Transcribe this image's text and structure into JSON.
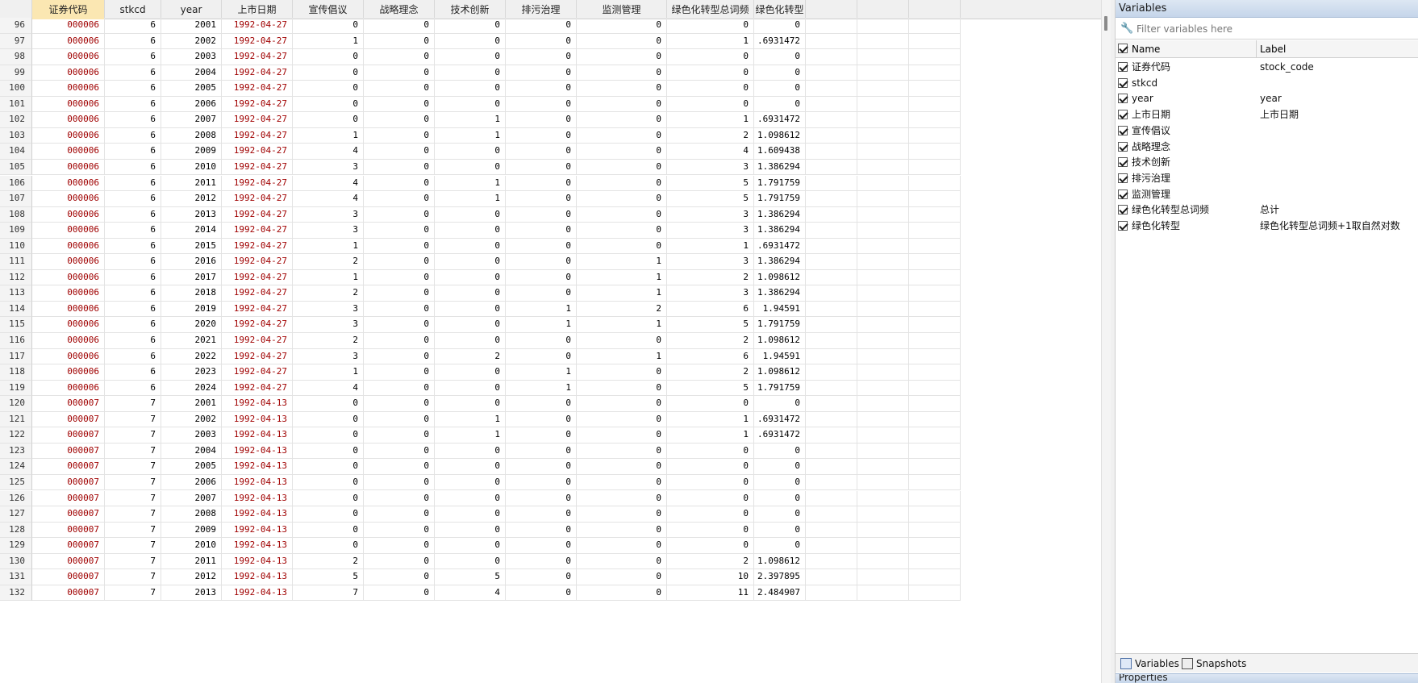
{
  "grid": {
    "columns": [
      "证券代码",
      "stkcd",
      "year",
      "上市日期",
      "宣传倡议",
      "战略理念",
      "技术创新",
      "排污治理",
      "监测管理",
      "绿色化转型总词频",
      "绿色化转型"
    ],
    "rows": [
      [
        "96",
        "000006",
        "6",
        "2001",
        "1992-04-27",
        "0",
        "0",
        "0",
        "0",
        "0",
        "0",
        "0"
      ],
      [
        "97",
        "000006",
        "6",
        "2002",
        "1992-04-27",
        "1",
        "0",
        "0",
        "0",
        "0",
        "1",
        ".6931472"
      ],
      [
        "98",
        "000006",
        "6",
        "2003",
        "1992-04-27",
        "0",
        "0",
        "0",
        "0",
        "0",
        "0",
        "0"
      ],
      [
        "99",
        "000006",
        "6",
        "2004",
        "1992-04-27",
        "0",
        "0",
        "0",
        "0",
        "0",
        "0",
        "0"
      ],
      [
        "100",
        "000006",
        "6",
        "2005",
        "1992-04-27",
        "0",
        "0",
        "0",
        "0",
        "0",
        "0",
        "0"
      ],
      [
        "101",
        "000006",
        "6",
        "2006",
        "1992-04-27",
        "0",
        "0",
        "0",
        "0",
        "0",
        "0",
        "0"
      ],
      [
        "102",
        "000006",
        "6",
        "2007",
        "1992-04-27",
        "0",
        "0",
        "1",
        "0",
        "0",
        "1",
        ".6931472"
      ],
      [
        "103",
        "000006",
        "6",
        "2008",
        "1992-04-27",
        "1",
        "0",
        "1",
        "0",
        "0",
        "2",
        "1.098612"
      ],
      [
        "104",
        "000006",
        "6",
        "2009",
        "1992-04-27",
        "4",
        "0",
        "0",
        "0",
        "0",
        "4",
        "1.609438"
      ],
      [
        "105",
        "000006",
        "6",
        "2010",
        "1992-04-27",
        "3",
        "0",
        "0",
        "0",
        "0",
        "3",
        "1.386294"
      ],
      [
        "106",
        "000006",
        "6",
        "2011",
        "1992-04-27",
        "4",
        "0",
        "1",
        "0",
        "0",
        "5",
        "1.791759"
      ],
      [
        "107",
        "000006",
        "6",
        "2012",
        "1992-04-27",
        "4",
        "0",
        "1",
        "0",
        "0",
        "5",
        "1.791759"
      ],
      [
        "108",
        "000006",
        "6",
        "2013",
        "1992-04-27",
        "3",
        "0",
        "0",
        "0",
        "0",
        "3",
        "1.386294"
      ],
      [
        "109",
        "000006",
        "6",
        "2014",
        "1992-04-27",
        "3",
        "0",
        "0",
        "0",
        "0",
        "3",
        "1.386294"
      ],
      [
        "110",
        "000006",
        "6",
        "2015",
        "1992-04-27",
        "1",
        "0",
        "0",
        "0",
        "0",
        "1",
        ".6931472"
      ],
      [
        "111",
        "000006",
        "6",
        "2016",
        "1992-04-27",
        "2",
        "0",
        "0",
        "0",
        "1",
        "3",
        "1.386294"
      ],
      [
        "112",
        "000006",
        "6",
        "2017",
        "1992-04-27",
        "1",
        "0",
        "0",
        "0",
        "1",
        "2",
        "1.098612"
      ],
      [
        "113",
        "000006",
        "6",
        "2018",
        "1992-04-27",
        "2",
        "0",
        "0",
        "0",
        "1",
        "3",
        "1.386294"
      ],
      [
        "114",
        "000006",
        "6",
        "2019",
        "1992-04-27",
        "3",
        "0",
        "0",
        "1",
        "2",
        "6",
        "1.94591"
      ],
      [
        "115",
        "000006",
        "6",
        "2020",
        "1992-04-27",
        "3",
        "0",
        "0",
        "1",
        "1",
        "5",
        "1.791759"
      ],
      [
        "116",
        "000006",
        "6",
        "2021",
        "1992-04-27",
        "2",
        "0",
        "0",
        "0",
        "0",
        "2",
        "1.098612"
      ],
      [
        "117",
        "000006",
        "6",
        "2022",
        "1992-04-27",
        "3",
        "0",
        "2",
        "0",
        "1",
        "6",
        "1.94591"
      ],
      [
        "118",
        "000006",
        "6",
        "2023",
        "1992-04-27",
        "1",
        "0",
        "0",
        "1",
        "0",
        "2",
        "1.098612"
      ],
      [
        "119",
        "000006",
        "6",
        "2024",
        "1992-04-27",
        "4",
        "0",
        "0",
        "1",
        "0",
        "5",
        "1.791759"
      ],
      [
        "120",
        "000007",
        "7",
        "2001",
        "1992-04-13",
        "0",
        "0",
        "0",
        "0",
        "0",
        "0",
        "0"
      ],
      [
        "121",
        "000007",
        "7",
        "2002",
        "1992-04-13",
        "0",
        "0",
        "1",
        "0",
        "0",
        "1",
        ".6931472"
      ],
      [
        "122",
        "000007",
        "7",
        "2003",
        "1992-04-13",
        "0",
        "0",
        "1",
        "0",
        "0",
        "1",
        ".6931472"
      ],
      [
        "123",
        "000007",
        "7",
        "2004",
        "1992-04-13",
        "0",
        "0",
        "0",
        "0",
        "0",
        "0",
        "0"
      ],
      [
        "124",
        "000007",
        "7",
        "2005",
        "1992-04-13",
        "0",
        "0",
        "0",
        "0",
        "0",
        "0",
        "0"
      ],
      [
        "125",
        "000007",
        "7",
        "2006",
        "1992-04-13",
        "0",
        "0",
        "0",
        "0",
        "0",
        "0",
        "0"
      ],
      [
        "126",
        "000007",
        "7",
        "2007",
        "1992-04-13",
        "0",
        "0",
        "0",
        "0",
        "0",
        "0",
        "0"
      ],
      [
        "127",
        "000007",
        "7",
        "2008",
        "1992-04-13",
        "0",
        "0",
        "0",
        "0",
        "0",
        "0",
        "0"
      ],
      [
        "128",
        "000007",
        "7",
        "2009",
        "1992-04-13",
        "0",
        "0",
        "0",
        "0",
        "0",
        "0",
        "0"
      ],
      [
        "129",
        "000007",
        "7",
        "2010",
        "1992-04-13",
        "0",
        "0",
        "0",
        "0",
        "0",
        "0",
        "0"
      ],
      [
        "130",
        "000007",
        "7",
        "2011",
        "1992-04-13",
        "2",
        "0",
        "0",
        "0",
        "0",
        "2",
        "1.098612"
      ],
      [
        "131",
        "000007",
        "7",
        "2012",
        "1992-04-13",
        "5",
        "0",
        "5",
        "0",
        "0",
        "10",
        "2.397895"
      ],
      [
        "132",
        "000007",
        "7",
        "2013",
        "1992-04-13",
        "7",
        "0",
        "4",
        "0",
        "0",
        "11",
        "2.484907"
      ]
    ]
  },
  "variables": {
    "title": "Variables",
    "filter_placeholder": "Filter variables here",
    "header_name": "Name",
    "header_label": "Label",
    "items": [
      {
        "name": "证券代码",
        "label": "stock_code"
      },
      {
        "name": "stkcd",
        "label": ""
      },
      {
        "name": "year",
        "label": "year"
      },
      {
        "name": "上市日期",
        "label": "上市日期"
      },
      {
        "name": "宣传倡议",
        "label": ""
      },
      {
        "name": "战略理念",
        "label": ""
      },
      {
        "name": "技术创新",
        "label": ""
      },
      {
        "name": "排污治理",
        "label": ""
      },
      {
        "name": "监测管理",
        "label": ""
      },
      {
        "name": "绿色化转型总词频",
        "label": "总计"
      },
      {
        "name": "绿色化转型",
        "label": "绿色化转型总词频+1取自然对数"
      }
    ],
    "tabs": [
      {
        "label": "Variables",
        "icon": "variables-icon"
      },
      {
        "label": "Snapshots",
        "icon": "snapshots-icon"
      }
    ],
    "properties_title": "Properties"
  },
  "colors": {
    "string_text": "#a00000",
    "selected_header": "#fbe7b2",
    "panel_title": "#c5d5ea"
  }
}
